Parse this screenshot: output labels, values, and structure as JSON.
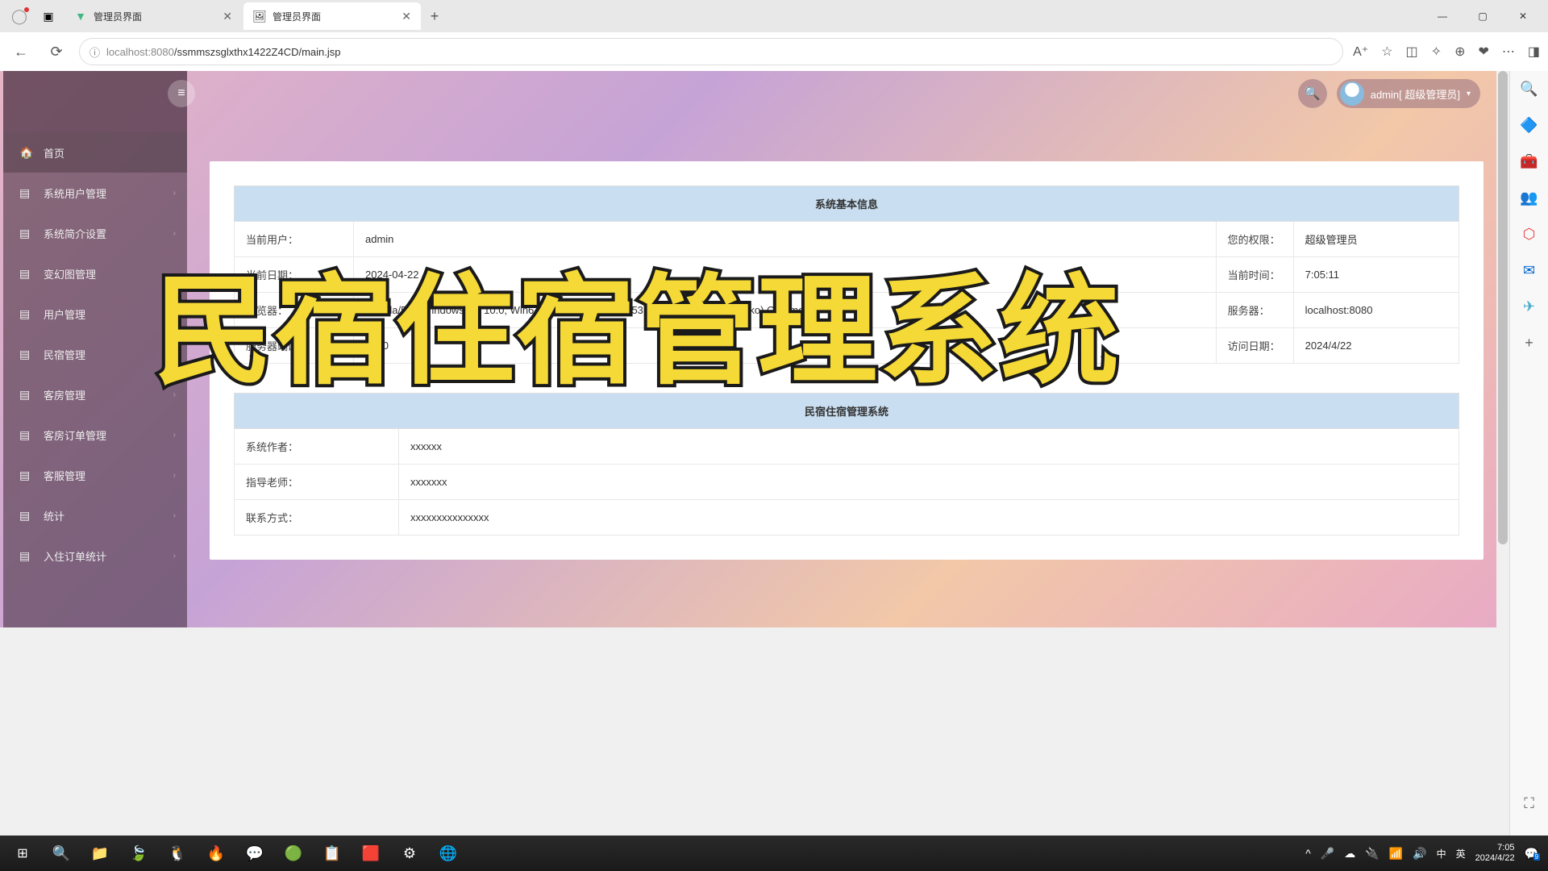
{
  "browser": {
    "tabs": [
      {
        "title": "管理员界面",
        "favicon": "vue"
      },
      {
        "title": "管理员界面",
        "favicon": "img"
      }
    ],
    "url_host": "localhost",
    "url_port": ":8080",
    "url_path": "/ssmmszsglxthx1422Z4CD/main.jsp"
  },
  "header": {
    "user_label": "admin[ 超级管理员]"
  },
  "sidebar": {
    "items": [
      {
        "label": "首页",
        "icon": "dashboard",
        "expandable": false
      },
      {
        "label": "系统用户管理",
        "icon": "list",
        "expandable": true
      },
      {
        "label": "系统简介设置",
        "icon": "list",
        "expandable": true
      },
      {
        "label": "变幻图管理",
        "icon": "list",
        "expandable": false
      },
      {
        "label": "用户管理",
        "icon": "list",
        "expandable": false
      },
      {
        "label": "民宿管理",
        "icon": "list",
        "expandable": true
      },
      {
        "label": "客房管理",
        "icon": "list",
        "expandable": true
      },
      {
        "label": "客房订单管理",
        "icon": "list",
        "expandable": true
      },
      {
        "label": "客服管理",
        "icon": "list",
        "expandable": true
      },
      {
        "label": "统计",
        "icon": "list",
        "expandable": true
      },
      {
        "label": "入住订单统计",
        "icon": "list",
        "expandable": true
      }
    ]
  },
  "tables": {
    "sys_info_header": "系统基本信息",
    "rows": [
      {
        "l1": "当前用户：",
        "v1": "admin",
        "l2": "您的权限：",
        "v2": "超级管理员"
      },
      {
        "l1": "当前日期：",
        "v1": "2024-04-22",
        "l2": "当前时间：",
        "v2": "7:05:11"
      },
      {
        "l1": "浏览器：",
        "v1": "Mozilla/5.0 (Windows NT 10.0; Win64; x64) AppleWebKit/537.36 (KHTML, like Gecko) Chrome/...",
        "l2": "服务器：",
        "v2": "localhost:8080"
      },
      {
        "l1": "服务器端口：",
        "v1": "8080",
        "l2": "访问日期：",
        "v2": "2024/4/22"
      }
    ],
    "app_info_header": "民宿住宿管理系统",
    "rows2": [
      {
        "l": "系统作者：",
        "v": "xxxxxx"
      },
      {
        "l": "指导老师：",
        "v": "xxxxxxx"
      },
      {
        "l": "联系方式：",
        "v": "xxxxxxxxxxxxxxx"
      }
    ]
  },
  "overlay_title": "民宿住宿管理系统",
  "taskbar": {
    "ime": "英",
    "ime_mode": "中",
    "time": "7:05",
    "date": "2024/4/22",
    "notif_count": "9"
  }
}
